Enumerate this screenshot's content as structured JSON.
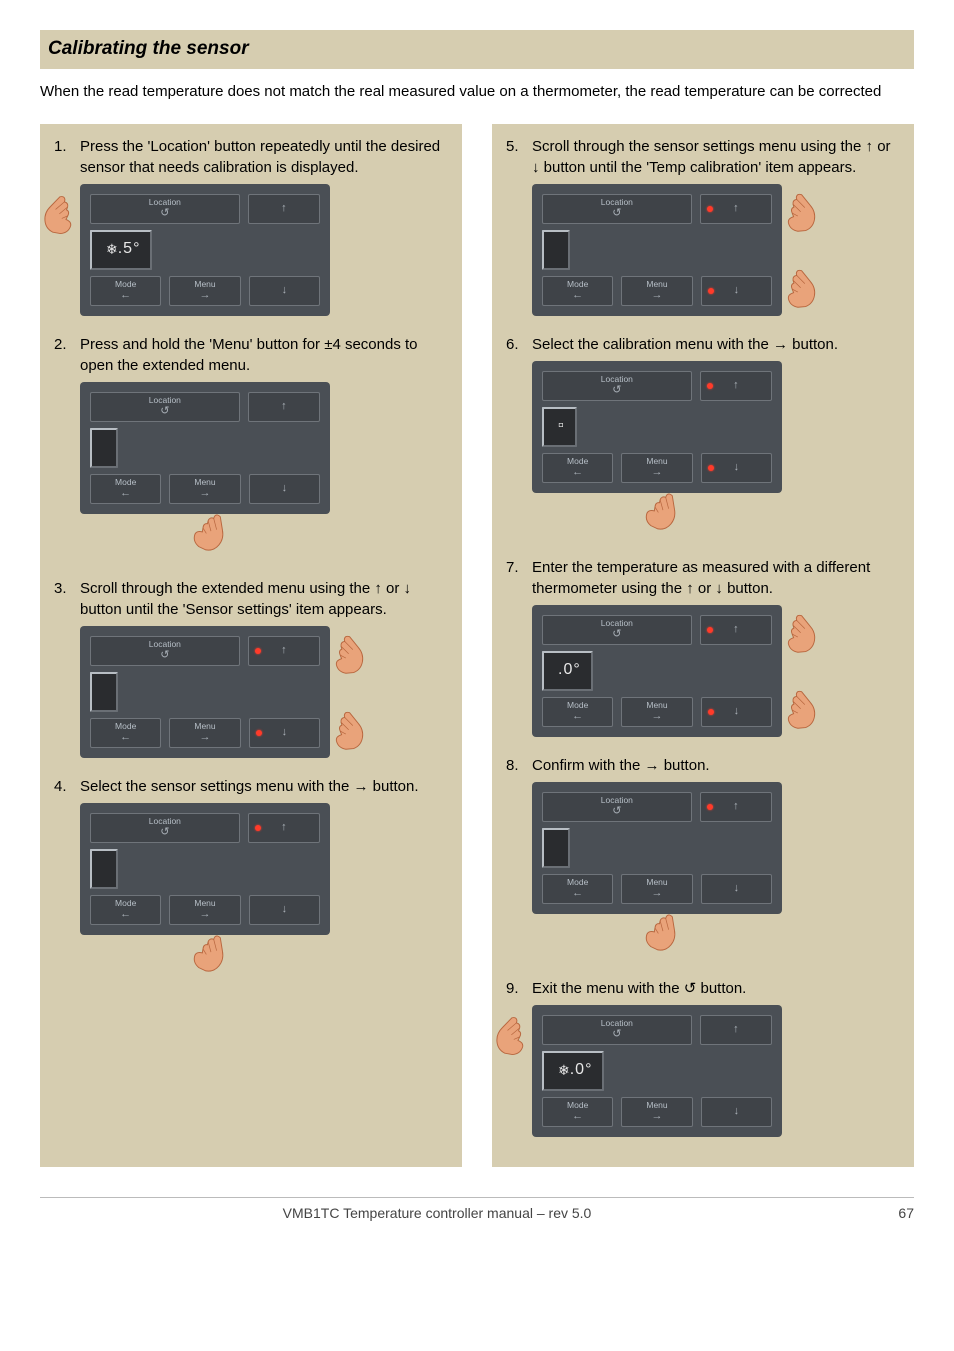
{
  "heading": "Calibrating the sensor",
  "intro": "When the read temperature does not match the real measured value on a thermometer, the read temperature can be corrected",
  "panel_labels": {
    "location": "Location",
    "location_sym": "↺",
    "mode": "Mode",
    "mode_sym": "←",
    "menu": "Menu",
    "menu_sym": "→",
    "up": "↑",
    "down": "↓"
  },
  "left_steps": [
    {
      "num": "1.",
      "text": "Press the 'Location' button repeatedly until the desired sensor that needs calibration is displayed.",
      "hand": "left-loc",
      "leds": false,
      "display_left": "❄",
      "display_right": ".5°",
      "hand_below": ""
    },
    {
      "num": "2.",
      "text": "Press and hold the 'Menu' button for ±4 seconds to open the extended menu.",
      "hand": "below-menu",
      "leds": false,
      "display_left": "",
      "display_right": "",
      "hand_below": "menu"
    },
    {
      "num": "3.",
      "text": "Scroll through the extended menu using the ↑ or ↓ button until the 'Sensor settings' item appears.",
      "hand": "right-arrows",
      "leds": true,
      "display_left": "",
      "display_right": "",
      "hand_below": ""
    },
    {
      "num": "4.",
      "text": "Select the sensor settings menu with the → button.",
      "hand": "below-menu",
      "leds": false,
      "led_up_only": true,
      "display_left": "",
      "display_right": "",
      "hand_below": "menu"
    }
  ],
  "right_steps": [
    {
      "num": "5.",
      "text": "Scroll through the sensor settings menu using the ↑ or ↓ button until the 'Temp calibration' item appears.",
      "hand": "right-arrows",
      "leds": true,
      "display_left": "",
      "display_right": ""
    },
    {
      "num": "6.",
      "text": "Select the calibration menu with the → button.",
      "hand": "below-menu",
      "leds": true,
      "display_left": "",
      "display_right": "▫",
      "hand_below": "menu"
    },
    {
      "num": "7.",
      "text": "Enter the temperature as measured with a different thermometer using the ↑ or ↓ button.",
      "hand": "right-arrows",
      "leds": true,
      "display_left": "",
      "display_right": ".0°"
    },
    {
      "num": "8.",
      "text": "Confirm with the → button.",
      "hand": "below-menu",
      "leds": false,
      "led_up_only": true,
      "display_left": "",
      "display_right": "",
      "hand_below": "menu"
    },
    {
      "num": "9.",
      "text": "Exit the menu with the ↺ button.",
      "hand": "left-loc",
      "leds": false,
      "display_left": "❄",
      "display_right": ".0°"
    }
  ],
  "footer": {
    "title": "VMB1TC Temperature controller manual – rev 5.0",
    "page": "67"
  }
}
